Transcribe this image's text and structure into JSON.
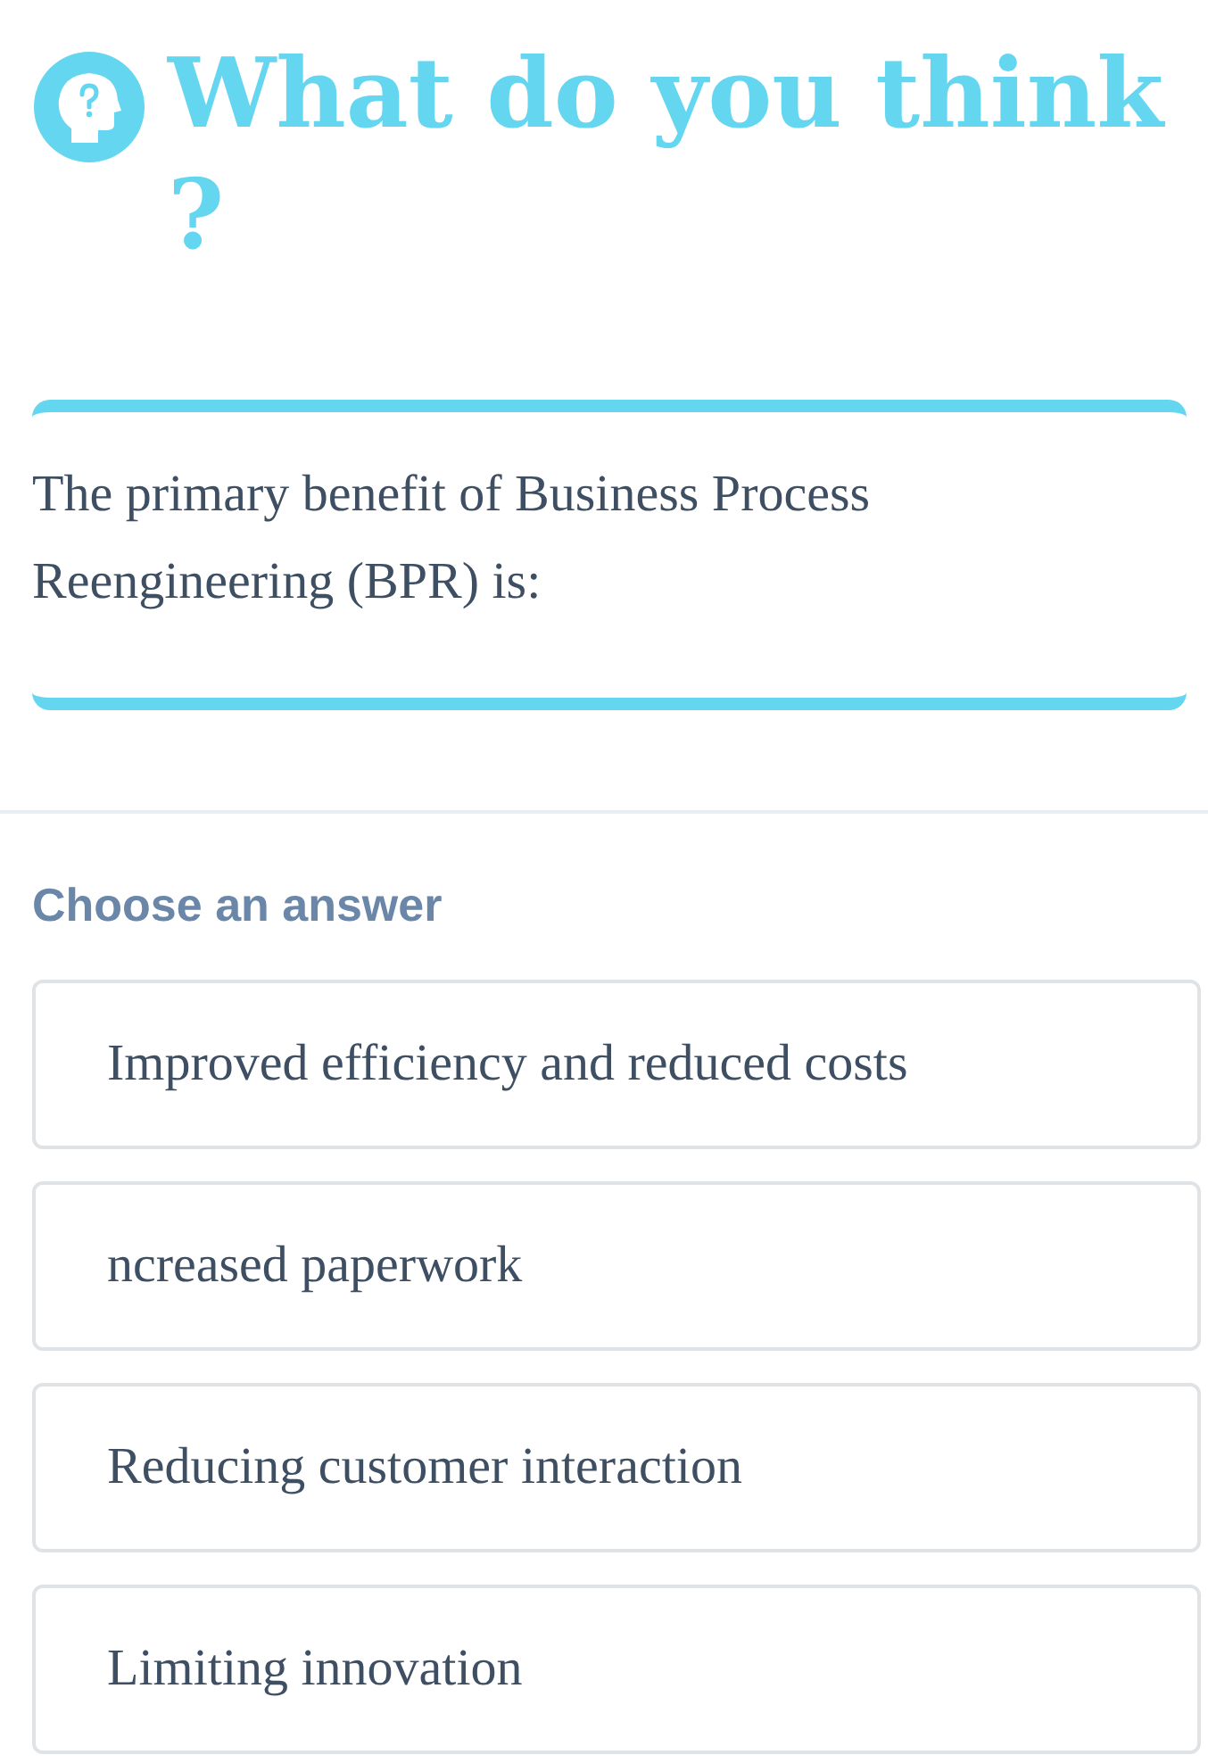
{
  "header": {
    "title": "What do you think ?"
  },
  "question": {
    "text": "The primary benefit of Business Process Reengineering (BPR) is:"
  },
  "answers": {
    "label": "Choose an answer",
    "options": [
      {
        "text": "Improved efficiency and reduced costs"
      },
      {
        "text": "ncreased paperwork"
      },
      {
        "text": "Reducing customer interaction"
      },
      {
        "text": "Limiting innovation"
      }
    ]
  }
}
